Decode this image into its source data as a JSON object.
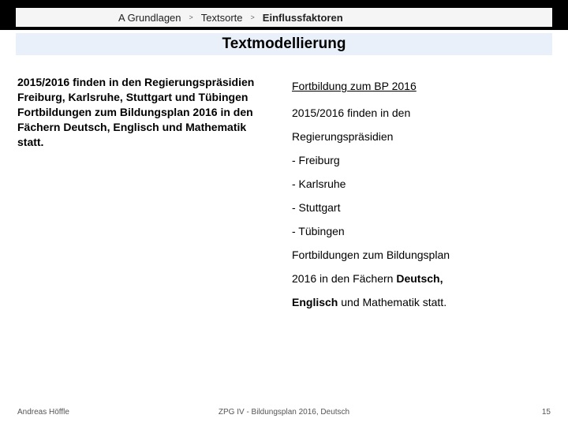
{
  "breadcrumb": {
    "level1": "A Grundlagen",
    "level2": "Textsorte",
    "level3": "Einflussfaktoren",
    "sep": ">"
  },
  "title": "Textmodellierung",
  "left_paragraph": "2015/2016 finden in den Regierungspräsidien Freiburg, Karlsruhe, Stuttgart und Tübingen Fortbildungen zum Bildungsplan 2016 in den Fächern Deutsch, Englisch und Mathematik statt.",
  "right": {
    "heading": "Fortbildung zum BP 2016",
    "line1": "2015/2016 finden in den",
    "line2": "Regierungspräsidien",
    "bullets": [
      "- Freiburg",
      "- Karlsruhe",
      "- Stuttgart",
      "- Tübingen"
    ],
    "line3_pre": "Fortbildungen zum Bildungsplan",
    "line4_pre": "2016 in den Fächern ",
    "line4_bold1": "Deutsch,",
    "line5_bold": "Englisch",
    "line5_rest": " und Mathematik statt."
  },
  "footer": {
    "author": "Andreas Höffle",
    "center": "ZPG IV - Bildungsplan 2016, Deutsch",
    "page": "15"
  }
}
